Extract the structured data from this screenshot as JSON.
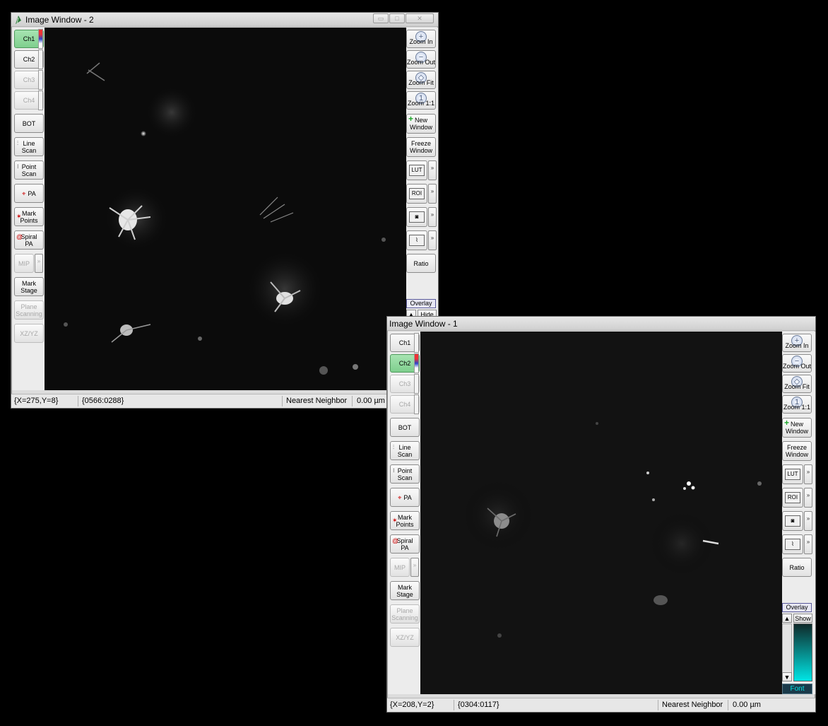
{
  "window2": {
    "title": "Image Window - 2",
    "controls": {
      "minimize": "▭",
      "maximize": "□",
      "close": "✕"
    },
    "channels": [
      "Ch1",
      "Ch2",
      "Ch3",
      "Ch4"
    ],
    "active_channel": "Ch1",
    "left_tools": {
      "bot": "BOT",
      "line_scan": [
        "Line",
        "Scan"
      ],
      "point_scan": [
        "Point",
        "Scan"
      ],
      "pa": "PA",
      "mark_points": [
        "Mark",
        "Points"
      ],
      "spiral_pa": [
        "Spiral",
        "PA"
      ],
      "mip": "MIP",
      "mark_stage": [
        "Mark",
        "Stage"
      ],
      "plane_scanning": [
        "Plane",
        "Scanning"
      ],
      "xz_yz": "XZ/YZ"
    },
    "right_tools": {
      "zoom_in": "Zoom In",
      "zoom_out": "Zoom Out",
      "zoom_fit": "Zoom Fit",
      "zoom_1_1": "Zoom 1:1",
      "new_window": [
        "New",
        "Window"
      ],
      "freeze_window": [
        "Freeze",
        "Window"
      ],
      "lut": "LUT",
      "roi": "ROI",
      "ratio": "Ratio",
      "overlay": "Overlay",
      "hide": "Hide"
    },
    "status": {
      "cursor": "{X=275,Y=8}",
      "value": "{0566:0288}",
      "interpolation": "Nearest Neighbor",
      "distance": "0.00 µm"
    }
  },
  "window1": {
    "title": "Image Window - 1",
    "channels": [
      "Ch1",
      "Ch2",
      "Ch3",
      "Ch4"
    ],
    "active_channel": "Ch2",
    "left_tools": {
      "bot": "BOT",
      "line_scan": [
        "Line",
        "Scan"
      ],
      "point_scan": [
        "Point",
        "Scan"
      ],
      "pa": "PA",
      "mark_points": [
        "Mark",
        "Points"
      ],
      "spiral_pa": [
        "Spiral",
        "PA"
      ],
      "mip": "MIP",
      "mark_stage": [
        "Mark",
        "Stage"
      ],
      "plane_scanning": [
        "Plane",
        "Scanning"
      ],
      "xz_yz": "XZ/YZ"
    },
    "right_tools": {
      "zoom_in": "Zoom In",
      "zoom_out": "Zoom Out",
      "zoom_fit": "Zoom Fit",
      "zoom_1_1": "Zoom 1:1",
      "new_window": [
        "New",
        "Window"
      ],
      "freeze_window": [
        "Freeze",
        "Window"
      ],
      "lut": "LUT",
      "roi": "ROI",
      "ratio": "Ratio",
      "overlay": "Overlay",
      "show": "Show",
      "font": "Font"
    },
    "overlay_color": "#00e5e5",
    "status": {
      "cursor": "{X=208,Y=2}",
      "value": "{0304:0117}",
      "interpolation": "Nearest Neighbor",
      "distance": "0.00 µm"
    }
  }
}
